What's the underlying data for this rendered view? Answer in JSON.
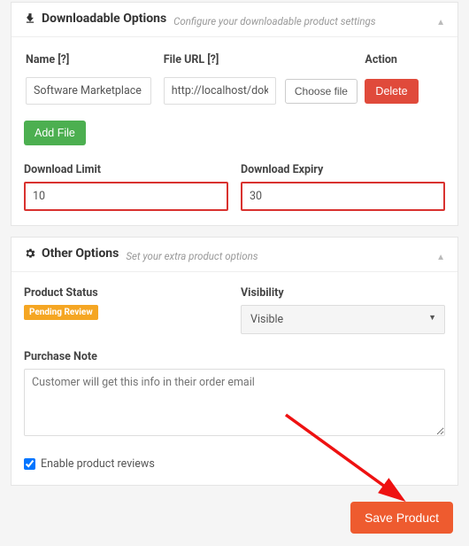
{
  "downloadable": {
    "title": "Downloadable Options",
    "subtitle": "Configure your downloadable product settings",
    "headers": {
      "name": "Name [?]",
      "url": "File URL [?]",
      "action": "Action"
    },
    "file": {
      "name": "Software Marketplace",
      "url": "http://localhost/dokan/w",
      "choose": "Choose file",
      "delete": "Delete"
    },
    "add_file": "Add File",
    "limit": {
      "label": "Download Limit",
      "value": "10"
    },
    "expiry": {
      "label": "Download Expiry",
      "value": "30"
    }
  },
  "other": {
    "title": "Other Options",
    "subtitle": "Set your extra product options",
    "status": {
      "label": "Product Status",
      "badge": "Pending Review"
    },
    "visibility": {
      "label": "Visibility",
      "value": "Visible"
    },
    "note": {
      "label": "Purchase Note",
      "placeholder": "Customer will get this info in their order email"
    },
    "reviews": "Enable product reviews"
  },
  "save": "Save Product"
}
